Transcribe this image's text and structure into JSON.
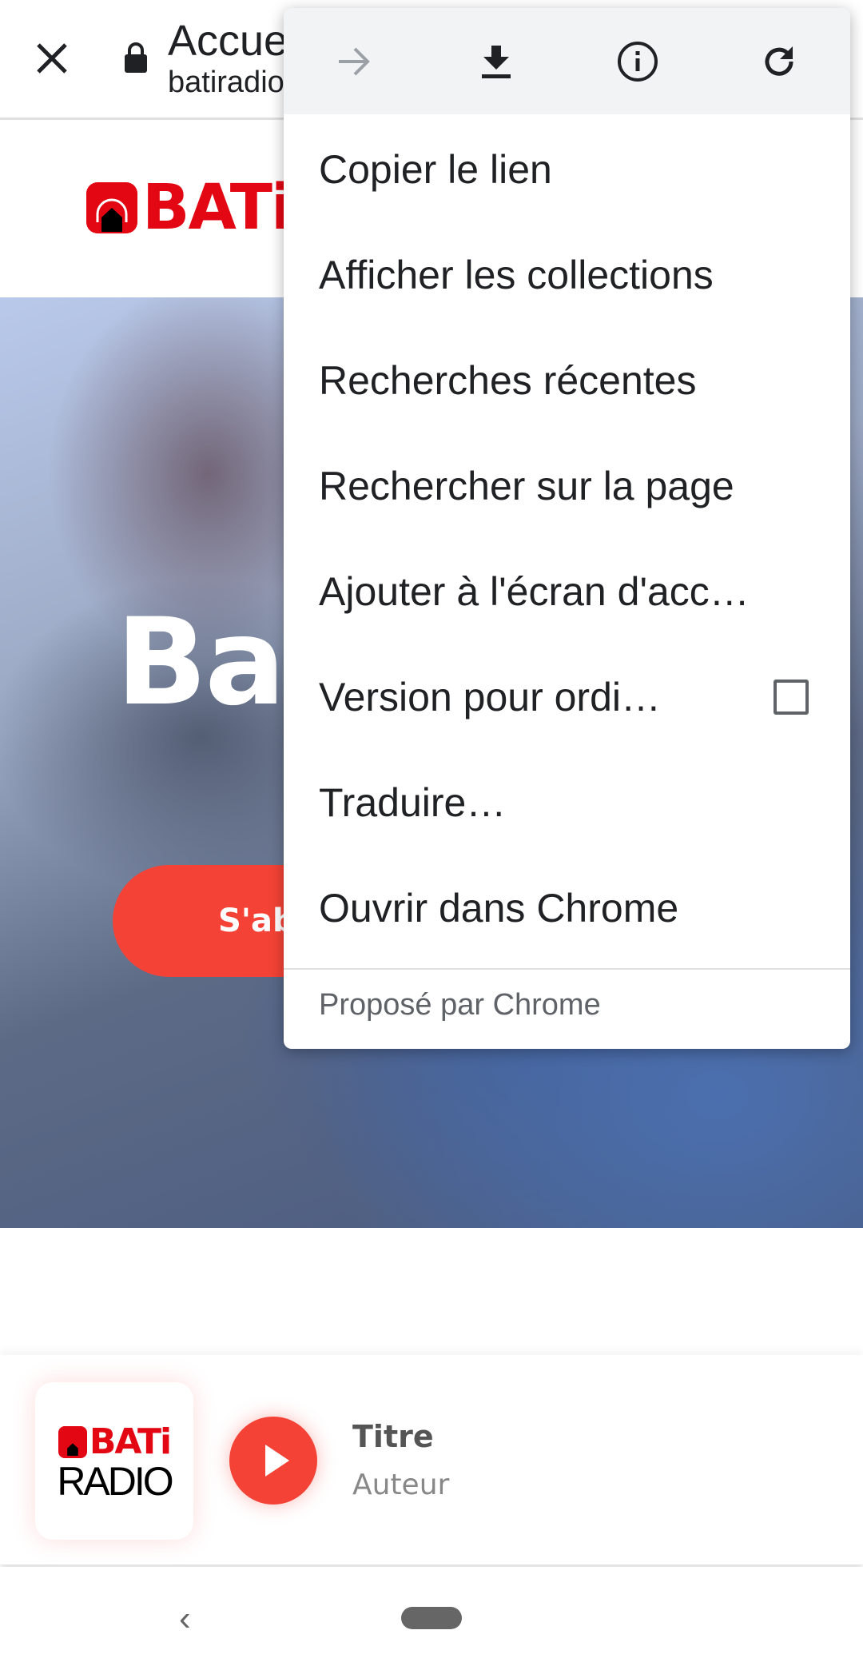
{
  "browser": {
    "title": "Accue",
    "url": "batiradio",
    "close_icon": "close-icon",
    "lock_icon": "lock-icon"
  },
  "site": {
    "logo_text": "BATi",
    "hero_title": "Bat",
    "hero_button": "S'ab"
  },
  "player": {
    "logo_top": "BATi",
    "logo_bottom": "RADIO",
    "title": "Titre",
    "author": "Auteur",
    "accent": "#f44336"
  },
  "menu": {
    "icons": [
      "forward-icon",
      "download-icon",
      "info-icon",
      "refresh-icon"
    ],
    "items": [
      {
        "label": "Copier le lien"
      },
      {
        "label": "Afficher les collections"
      },
      {
        "label": "Recherches récentes"
      },
      {
        "label": "Rechercher sur la page"
      },
      {
        "label": "Ajouter à l'écran d'acc…"
      },
      {
        "label": "Version pour ordi…",
        "checked": false
      },
      {
        "label": "Traduire…"
      },
      {
        "label": "Ouvrir dans Chrome"
      }
    ],
    "footer": "Proposé par Chrome"
  },
  "navbar": {
    "back": "‹"
  }
}
